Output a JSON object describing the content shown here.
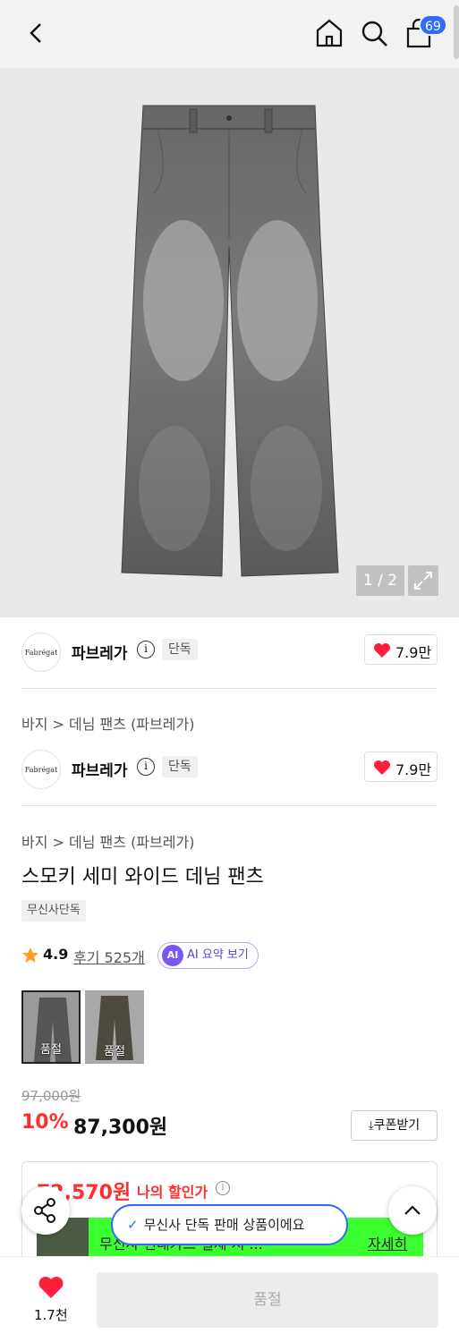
{
  "topbar": {
    "back_icon": "chevron-left-icon",
    "home_icon": "home-icon",
    "search_icon": "search-icon",
    "cart_icon": "shopping-bag-icon",
    "cart_badge": "69"
  },
  "gallery": {
    "pager": "1 / 2",
    "expand_icon": "expand-icon"
  },
  "brand_blocks": [
    {
      "logo": "Fabrégat",
      "name": "파브레가",
      "tag": "단독",
      "likes": "7.9만"
    },
    {
      "logo": "Fabrégat",
      "name": "파브레가",
      "tag": "단독",
      "likes": "7.9만"
    }
  ],
  "breadcrumbs": [
    "바지 > 데님 팬츠 (파브레가)",
    "바지 > 데님 팬츠 (파브레가)"
  ],
  "product": {
    "title": "스모키 세미 와이드 데님 팬츠",
    "exclusive_chip": "무신사단독",
    "rating": "4.9",
    "reviews": "후기 525개",
    "ai_logo": "AI",
    "ai_label": "AI 요약 보기"
  },
  "options": [
    {
      "label": "품절",
      "selected": true
    },
    {
      "label": "품절",
      "selected": false
    }
  ],
  "price": {
    "original": "97,000원",
    "discount": "10%",
    "sale": "87,300원",
    "coupon_button": "쿠폰받기"
  },
  "my_discount": {
    "price": "72,570원",
    "label": "나의 할인가",
    "banner_text": "무신사 현대카드 결제 시 ...",
    "detail_link": "자세히"
  },
  "toast": {
    "text": "무신사 단독 판매 상품이에요"
  },
  "bottom": {
    "fav_count": "1.7천",
    "buy_button": "품절"
  },
  "colors": {
    "accent_blue": "#2f6bff",
    "sale_red": "#ff2d2d",
    "ai_purple": "#7b57f0",
    "banner_green": "#3bff2f"
  }
}
